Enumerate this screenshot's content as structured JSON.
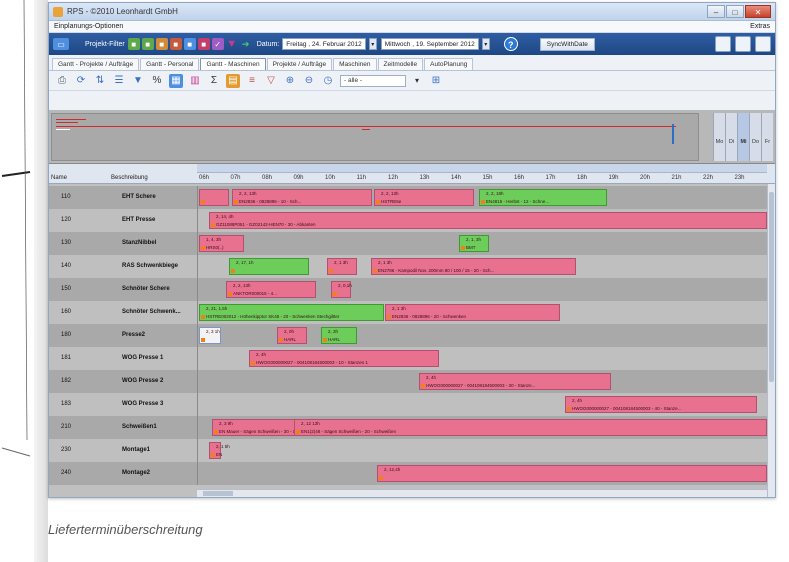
{
  "window": {
    "title": "RPS - ©2010 Leonhardt GmbH",
    "controls": [
      "–",
      "□",
      "✕"
    ]
  },
  "menu": {
    "left": "Einplanungs-Optionen",
    "right": "Extras"
  },
  "toolbar": {
    "filter_label": "Projekt-Filter",
    "from_label": "Datum:",
    "from_value": "Freitag , 24. Februar 2012",
    "to_value": "Mittwoch , 19. September 2012",
    "sync_label": "SyncWithDate"
  },
  "tabs": [
    {
      "label": "Gantt - Projekte / Aufträge"
    },
    {
      "label": "Gantt - Personal"
    },
    {
      "label": "Gantt - Maschinen"
    },
    {
      "label": "Projekte / Aufträge"
    },
    {
      "label": "Maschinen"
    },
    {
      "label": "Zeitmodelle"
    },
    {
      "label": "AutoPlanung"
    }
  ],
  "zoom_field": "- alle -",
  "overview": {
    "days": [
      "Mo",
      "Di",
      "Mi",
      "Do",
      "Fr"
    ],
    "selected_day": "Mi"
  },
  "gantt": {
    "columns": {
      "name": "Name",
      "desc": "Beschreibung"
    },
    "hours": [
      "06h",
      "07h",
      "08h",
      "09h",
      "10h",
      "11h",
      "12h",
      "13h",
      "14h",
      "15h",
      "16h",
      "17h",
      "18h",
      "19h",
      "20h",
      "21h",
      "22h",
      "23h"
    ],
    "rows": [
      {
        "name": "110",
        "desc": "EHT Schere",
        "bars": [
          {
            "color": "pink",
            "t1": "",
            "t2": ""
          },
          {
            "color": "pink",
            "t1": "2, 2, 13h",
            "t2": "EN2836 - 0828896 - 10 - Sch..."
          },
          {
            "color": "pink",
            "t1": "2, 2, 13h",
            "t2": "HSTRE6e"
          },
          {
            "color": "green",
            "t1": "2, 2, 18h",
            "t2": "EN4815 - Herbst - 12 - Schne..."
          }
        ]
      },
      {
        "name": "120",
        "desc": "EHT Presse",
        "bars": [
          {
            "color": "pink",
            "t1": "2, 14, 4h",
            "t2": "GZ11088P051 - GZ02142-HEN70 - 30 - Abkanten"
          }
        ]
      },
      {
        "name": "130",
        "desc": "StanzNibbel",
        "bars": [
          {
            "color": "pink",
            "t1": "1, 4, 3h",
            "t2": "HRS0(..)"
          },
          {
            "color": "green",
            "t1": "2, 1, 3h",
            "t2": "BMT"
          }
        ]
      },
      {
        "name": "140",
        "desc": "RAS Schwenkbiege",
        "bars": [
          {
            "color": "green",
            "t1": "2, 17, 1h",
            "t2": ""
          },
          {
            "color": "pink",
            "t1": "2, 1 3h",
            "t2": ""
          },
          {
            "color": "pink",
            "t1": "2, 1 3h",
            "t2": "EN2786 - Kampodil Nov. 200mm 80 / 100 / 15 - 20 - Sch..."
          }
        ]
      },
      {
        "name": "150",
        "desc": "Schnöter Schere",
        "bars": [
          {
            "color": "pink",
            "t1": "2, 2, 13h",
            "t2": "ANKTOR000015 - 4..."
          },
          {
            "color": "pink",
            "t1": "2, 0,1h",
            "t2": ""
          }
        ]
      },
      {
        "name": "160",
        "desc": "Schnöter Schwenk...",
        "bars": [
          {
            "color": "green",
            "t1": "2, 21, 1,5h",
            "t2": "HSTRE002012 - Höhenkipptor SK45 - 20 - Schwenken Stechgiltter"
          },
          {
            "color": "pink",
            "t1": "2, 1 3h",
            "t2": "EN2836 - 0828896 - 20 - Schwenken"
          }
        ]
      },
      {
        "name": "180",
        "desc": "Presse2",
        "bars": [
          {
            "color": "white",
            "t1": "2, 3 1h",
            "t2": ""
          },
          {
            "color": "pink",
            "t1": "2, 0h",
            "t2": "HARL"
          },
          {
            "color": "green",
            "t1": "2, 3h",
            "t2": "HARL"
          }
        ]
      },
      {
        "name": "181",
        "desc": "WOG Presse 1",
        "bars": [
          {
            "color": "pink",
            "t1": "2, 4h",
            "t2": "HWOG000000027 - 004108184500003 - 10 - Stanzen 1"
          }
        ]
      },
      {
        "name": "182",
        "desc": "WOG Presse 2",
        "bars": [
          {
            "color": "pink",
            "t1": "2, 4h",
            "t2": "HWOG000000027 - 004108184500003 - 30 - Stanze..."
          }
        ]
      },
      {
        "name": "183",
        "desc": "WOG Presse 3",
        "bars": [
          {
            "color": "pink",
            "t1": "2, 4h",
            "t2": "HWOG000000027 - 004108184500003 - 40 - Stanze..."
          }
        ]
      },
      {
        "name": "210",
        "desc": "Schweißen1",
        "bars": [
          {
            "color": "pink",
            "t1": "2, 3 9h",
            "t2": "EN Mauer - Sägen Schweißen - 30 - Schw..."
          },
          {
            "color": "pink",
            "t1": "2, 12 13h",
            "t2": "EN1(2)48 - Sägen Schweißen - 20 - Schweißen"
          }
        ]
      },
      {
        "name": "230",
        "desc": "Montage1",
        "bars": [
          {
            "color": "pink",
            "t1": "2, 1 5h",
            "t2": "EN"
          }
        ]
      },
      {
        "name": "240",
        "desc": "Montage2",
        "bars": [
          {
            "color": "pink",
            "t1": "2, 12,4h",
            "t2": ""
          }
        ]
      }
    ]
  },
  "caption": "Lieferterminüberschreitung"
}
